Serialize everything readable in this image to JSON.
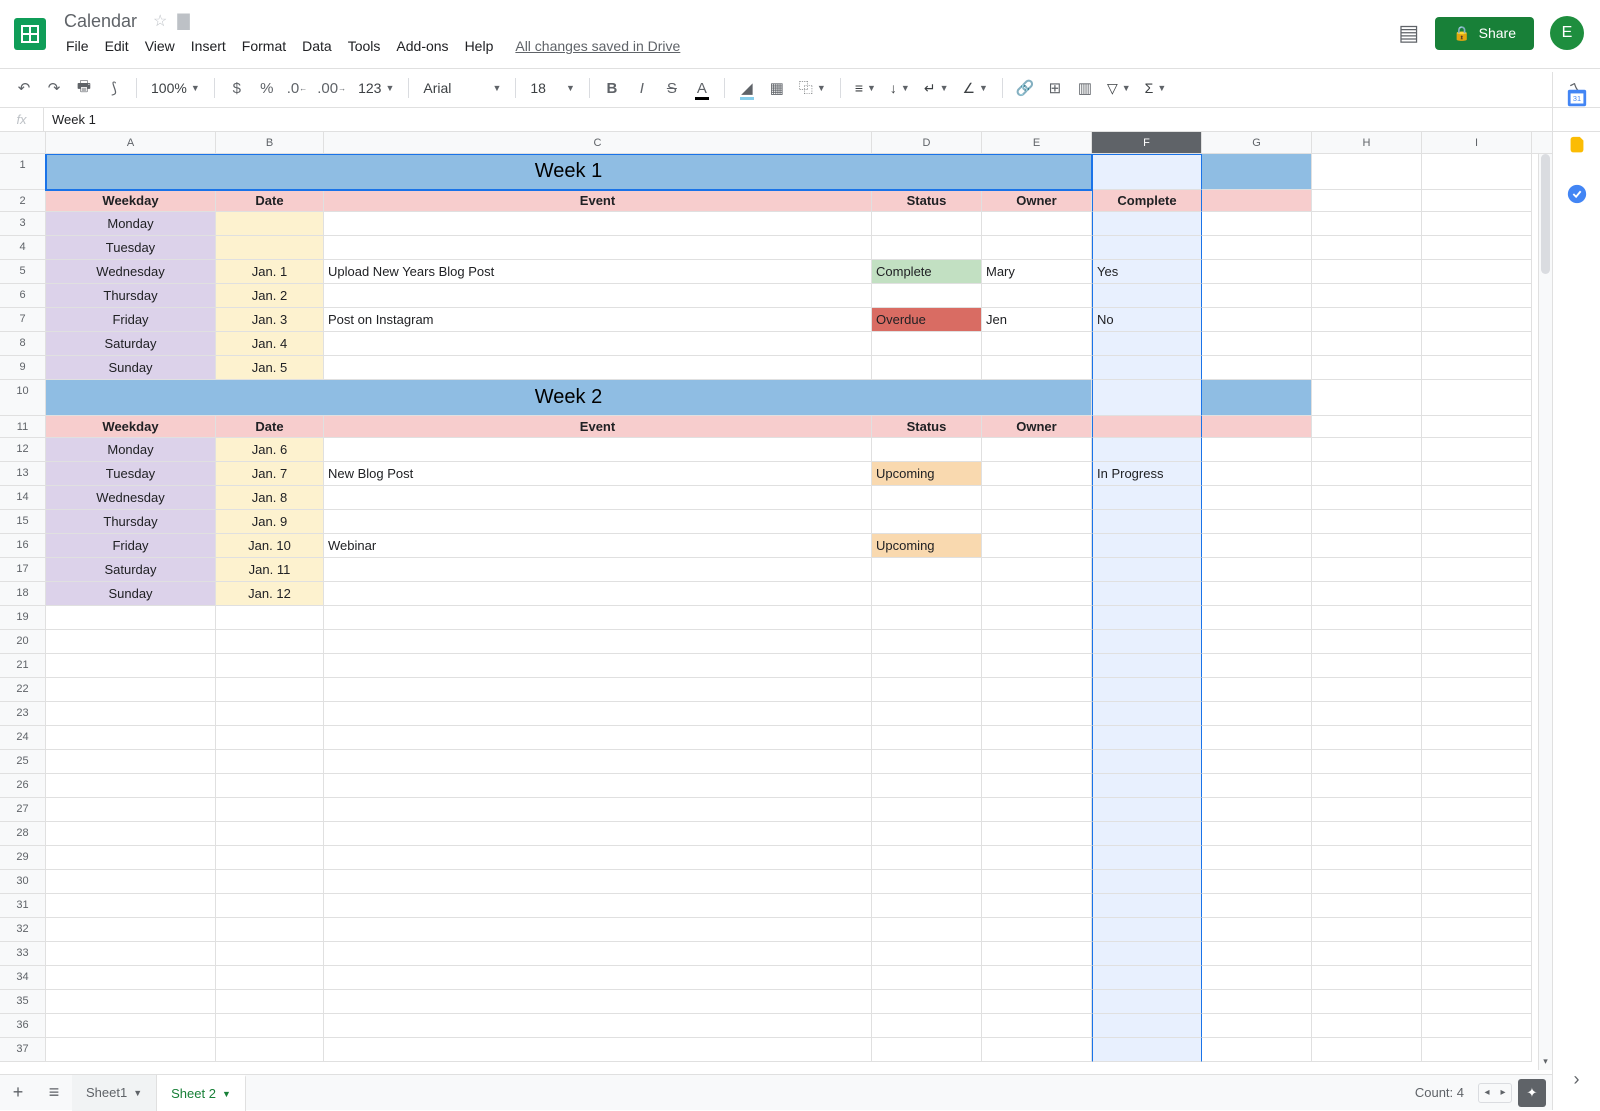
{
  "doc_title": "Calendar",
  "menus": [
    "File",
    "Edit",
    "View",
    "Insert",
    "Format",
    "Data",
    "Tools",
    "Add-ons",
    "Help"
  ],
  "saved_status": "All changes saved in Drive",
  "share_label": "Share",
  "avatar_initial": "E",
  "toolbar": {
    "zoom": "100%",
    "font": "Arial",
    "font_size": "18",
    "format_123": "123"
  },
  "formula_value": "Week 1",
  "columns": [
    "A",
    "B",
    "C",
    "D",
    "E",
    "F",
    "G",
    "H",
    "I"
  ],
  "selected_column": "F",
  "count_label": "Count: 4",
  "tabs": {
    "sheet1": "Sheet1",
    "sheet2": "Sheet 2"
  },
  "sheet": {
    "week1": {
      "title": "Week 1",
      "headers": {
        "weekday": "Weekday",
        "date": "Date",
        "event": "Event",
        "status": "Status",
        "owner": "Owner",
        "complete": "Complete"
      },
      "rows": [
        {
          "weekday": "Monday",
          "date": "",
          "event": "",
          "status": "",
          "owner": "",
          "complete": ""
        },
        {
          "weekday": "Tuesday",
          "date": "",
          "event": "",
          "status": "",
          "owner": "",
          "complete": ""
        },
        {
          "weekday": "Wednesday",
          "date": "Jan. 1",
          "event": "Upload New Years Blog Post",
          "status": "Complete",
          "status_class": "status-complete",
          "owner": "Mary",
          "complete": "Yes"
        },
        {
          "weekday": "Thursday",
          "date": "Jan. 2",
          "event": "",
          "status": "",
          "owner": "",
          "complete": ""
        },
        {
          "weekday": "Friday",
          "date": "Jan. 3",
          "event": "Post on Instagram",
          "status": "Overdue",
          "status_class": "status-overdue",
          "owner": "Jen",
          "complete": "No"
        },
        {
          "weekday": "Saturday",
          "date": "Jan. 4",
          "event": "",
          "status": "",
          "owner": "",
          "complete": ""
        },
        {
          "weekday": "Sunday",
          "date": "Jan. 5",
          "event": "",
          "status": "",
          "owner": "",
          "complete": ""
        }
      ]
    },
    "week2": {
      "title": "Week 2",
      "headers": {
        "weekday": "Weekday",
        "date": "Date",
        "event": "Event",
        "status": "Status",
        "owner": "Owner"
      },
      "rows": [
        {
          "weekday": "Monday",
          "date": "Jan. 6",
          "event": "",
          "status": "",
          "owner": "",
          "complete": ""
        },
        {
          "weekday": "Tuesday",
          "date": "Jan. 7",
          "event": "New Blog Post",
          "status": "Upcoming",
          "status_class": "status-upcoming",
          "owner": "",
          "complete": "In Progress"
        },
        {
          "weekday": "Wednesday",
          "date": "Jan. 8",
          "event": "",
          "status": "",
          "owner": "",
          "complete": ""
        },
        {
          "weekday": "Thursday",
          "date": "Jan. 9",
          "event": "",
          "status": "",
          "owner": "",
          "complete": ""
        },
        {
          "weekday": "Friday",
          "date": "Jan. 10",
          "event": "Webinar",
          "status": "Upcoming",
          "status_class": "status-upcoming",
          "owner": "",
          "complete": ""
        },
        {
          "weekday": "Saturday",
          "date": "Jan. 11",
          "event": "",
          "status": "",
          "owner": "",
          "complete": ""
        },
        {
          "weekday": "Sunday",
          "date": "Jan. 12",
          "event": "",
          "status": "",
          "owner": "",
          "complete": ""
        }
      ]
    }
  }
}
